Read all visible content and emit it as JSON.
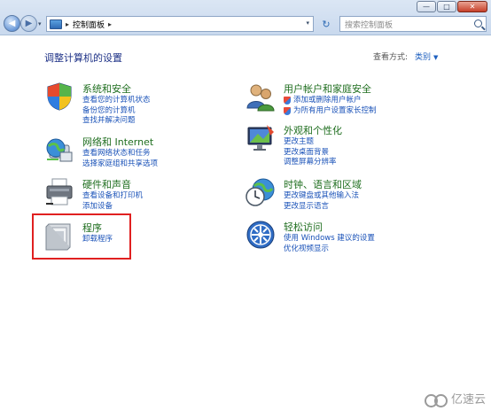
{
  "window": {
    "controls": {
      "minimize": "—",
      "maximize": "□",
      "close": "✕"
    }
  },
  "nav": {
    "back_glyph": "◀",
    "forward_glyph": "▶",
    "dropdown_glyph": "▾"
  },
  "address": {
    "separator": "▸",
    "crumb": "控制面板",
    "dropdown_glyph": "▾"
  },
  "refresh_glyph": "↻",
  "search": {
    "placeholder": "搜索控制面板"
  },
  "header": {
    "title": "调整计算机的设置",
    "view_by_label": "查看方式:",
    "view_by_value": "类别",
    "view_by_caret": "▼"
  },
  "categories": [
    {
      "title": "系统和安全",
      "icon": "shield-flag-icon",
      "links": [
        {
          "text": "查看您的计算机状态",
          "shield": false
        },
        {
          "text": "备份您的计算机",
          "shield": false
        },
        {
          "text": "查找并解决问题",
          "shield": false
        }
      ]
    },
    {
      "title": "网络和 Internet",
      "icon": "network-globe-icon",
      "links": [
        {
          "text": "查看网络状态和任务",
          "shield": false
        },
        {
          "text": "选择家庭组和共享选项",
          "shield": false
        }
      ]
    },
    {
      "title": "硬件和声音",
      "icon": "printer-icon",
      "links": [
        {
          "text": "查看设备和打印机",
          "shield": false
        },
        {
          "text": "添加设备",
          "shield": false
        }
      ]
    },
    {
      "title": "程序",
      "icon": "programs-icon",
      "links": [
        {
          "text": "卸载程序",
          "shield": false
        }
      ]
    },
    {
      "title": "用户帐户和家庭安全",
      "icon": "users-icon",
      "links": [
        {
          "text": "添加或删除用户帐户",
          "shield": true
        },
        {
          "text": "为所有用户设置家长控制",
          "shield": true
        }
      ]
    },
    {
      "title": "外观和个性化",
      "icon": "monitor-paint-icon",
      "links": [
        {
          "text": "更改主题",
          "shield": false
        },
        {
          "text": "更改桌面背景",
          "shield": false
        },
        {
          "text": "调整屏幕分辨率",
          "shield": false
        }
      ]
    },
    {
      "title": "时钟、语言和区域",
      "icon": "clock-globe-icon",
      "links": [
        {
          "text": "更改键盘或其他输入法",
          "shield": false
        },
        {
          "text": "更改显示语言",
          "shield": false
        }
      ]
    },
    {
      "title": "轻松访问",
      "icon": "ease-of-access-icon",
      "links": [
        {
          "text": "使用 Windows 建议的设置",
          "shield": false
        },
        {
          "text": "优化视频显示",
          "shield": false
        }
      ]
    }
  ],
  "watermark": {
    "text": "亿速云"
  }
}
